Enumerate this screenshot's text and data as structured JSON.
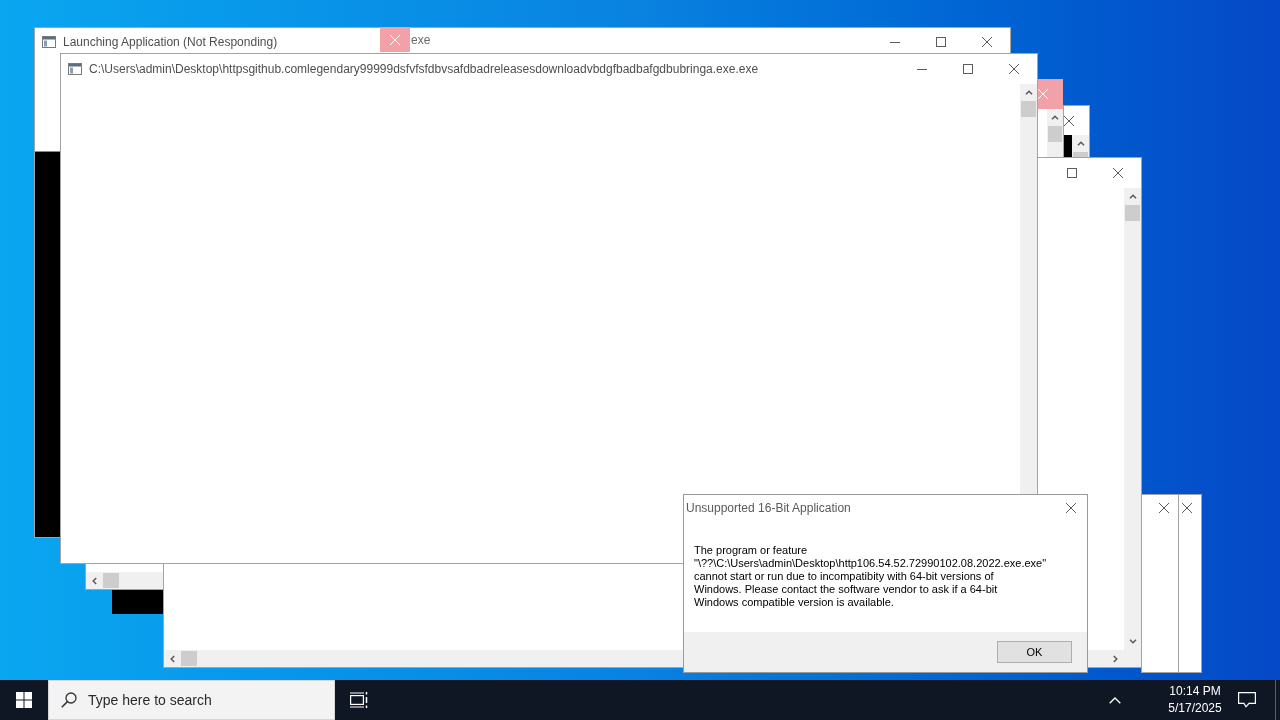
{
  "windows": [
    {
      "kind": "frozen",
      "title": "Launching Application (Not Responding)"
    },
    {
      "kind": "fragment",
      "title": "exe"
    },
    {
      "kind": "scrollable",
      "title": "C:\\Users\\admin\\Desktop\\httpsgithub.comlegendary99999dsfvfsfdbvsafdbadreleasesdownloadvbdgfbadbafgdbubringa.exe.exe"
    }
  ],
  "dialog": {
    "title": "Unsupported 16-Bit Application",
    "message": "The program or feature\n\"\\??\\C:\\Users\\admin\\Desktop\\http106.54.52.72990102.08.2022.exe.exe\"\ncannot start or run due to incompatibity with 64-bit versions of\nWindows. Please contact the software vendor to ask if a 64-bit\nWindows compatible version is available.",
    "buttons": [
      "OK"
    ]
  },
  "taskbar": {
    "search": {
      "placeholder": "Type here to search"
    },
    "clock": {
      "time": "10:14 PM",
      "date": "5/17/2025"
    }
  }
}
